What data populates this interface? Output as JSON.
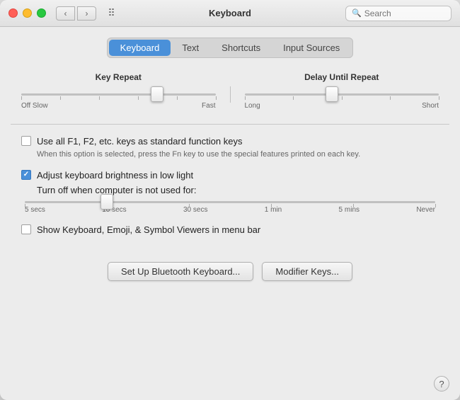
{
  "titlebar": {
    "title": "Keyboard",
    "search_placeholder": "Search",
    "back_label": "‹",
    "forward_label": "›",
    "grid_label": "⠿"
  },
  "tabs": [
    {
      "id": "keyboard",
      "label": "Keyboard",
      "active": true
    },
    {
      "id": "text",
      "label": "Text",
      "active": false
    },
    {
      "id": "shortcuts",
      "label": "Shortcuts",
      "active": false
    },
    {
      "id": "input-sources",
      "label": "Input Sources",
      "active": false
    }
  ],
  "key_repeat": {
    "label": "Key Repeat",
    "min_label": "Off Slow",
    "max_label": "Fast",
    "thumb_position_pct": 70
  },
  "delay_until_repeat": {
    "label": "Delay Until Repeat",
    "min_label": "Long",
    "max_label": "Short",
    "thumb_position_pct": 45
  },
  "fn_keys": {
    "checked": false,
    "main_label": "Use all F1, F2, etc. keys as standard function keys",
    "sub_label": "When this option is selected, press the Fn key to use the special features printed on each key."
  },
  "brightness": {
    "checked": true,
    "checkbox_label": "Adjust keyboard brightness in low light",
    "turn_off_label": "Turn off when computer is not used for:",
    "ticks": [
      "5 secs",
      "10 secs",
      "30 secs",
      "1 min",
      "5 mins",
      "Never"
    ],
    "thumb_position_pct": 25
  },
  "show_viewers": {
    "checked": false,
    "label": "Show Keyboard, Emoji, & Symbol Viewers in menu bar"
  },
  "buttons": {
    "bluetooth": "Set Up Bluetooth Keyboard...",
    "modifier": "Modifier Keys..."
  },
  "help": "?"
}
